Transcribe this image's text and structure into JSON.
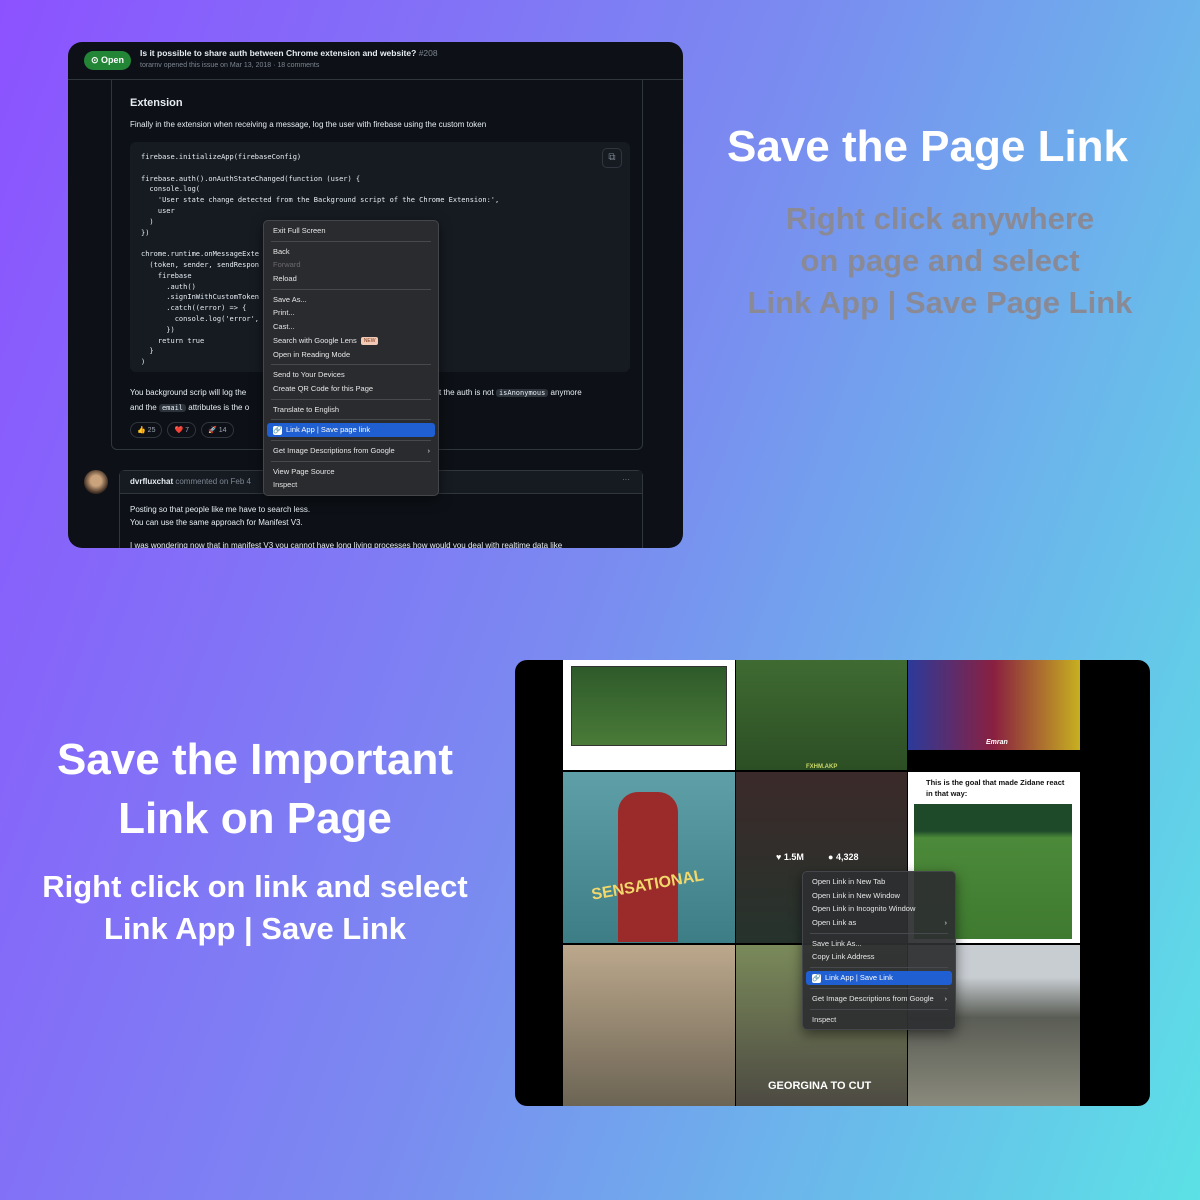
{
  "promo": {
    "top_title": "Save the Page Link",
    "top_sub": [
      "Right click anywhere",
      "on page and select",
      "Link App | Save Page Link"
    ],
    "bottom_title": [
      "Save the Important",
      "Link on Page"
    ],
    "bottom_sub": [
      "Right click  on link and select",
      "Link App | Save Link"
    ]
  },
  "colors": {
    "gradient_left": "#8c52ff",
    "gradient_right": "#5ce1e6",
    "subtitle_gray": "#8a8a96",
    "highlight": "#1f5fd1",
    "open_green": "#238636"
  },
  "issue": {
    "status": "Open",
    "title": "Is it possible to share auth between Chrome extension and website?",
    "number": "#208",
    "meta": "torarnv opened this issue on Mar 13, 2018 · 18 comments",
    "heading": "Extension",
    "intro": "Finally in the extension when receiving a message, log the user with firebase using the custom token",
    "code": "firebase.initializeApp(firebaseConfig)\n\nfirebase.auth().onAuthStateChanged(function (user) {\n  console.log(\n    'User state change detected from the Background script of the Chrome Extension:',\n    user\n  )\n})\n\nchrome.runtime.onMessageExte\n  (token, sender, sendRespon\n    firebase\n      .auth()\n      .signInWithCustomToken\n      .catch((error) => {\n        console.log('error',\n      })\n    return true\n  }\n)",
    "para_a": "You background scrip will log the",
    "para_b": "e that the auth is not",
    "code_inline1": "isAnonymous",
    "para_c": "anymore",
    "para_d": "and the",
    "code_inline2": "email",
    "para_e": "attributes is the o",
    "reactions": [
      {
        "emoji": "👍",
        "count": "25"
      },
      {
        "emoji": "❤️",
        "count": "7"
      },
      {
        "emoji": "🚀",
        "count": "14"
      }
    ],
    "comment_author": "dvrfluxchat",
    "comment_meta": "commented on Feb 4",
    "comment_more": "···",
    "comment_lines": [
      "Posting so that people like me have to search less.",
      "You can use the same approach for Manifest V3.",
      "",
      "I was wondering now that in manifest V3 you cannot have long living processes how would you deal with realtime data like"
    ]
  },
  "page_menu": {
    "items": [
      {
        "label": "Exit Full Screen"
      },
      {
        "sep": true
      },
      {
        "label": "Back"
      },
      {
        "label": "Forward",
        "disabled": true
      },
      {
        "label": "Reload"
      },
      {
        "sep": true
      },
      {
        "label": "Save As..."
      },
      {
        "label": "Print..."
      },
      {
        "label": "Cast..."
      },
      {
        "label": "Search with Google Lens",
        "badge": "NEW"
      },
      {
        "label": "Open in Reading Mode"
      },
      {
        "sep": true
      },
      {
        "label": "Send to Your Devices"
      },
      {
        "label": "Create QR Code for this Page"
      },
      {
        "sep": true
      },
      {
        "label": "Translate to English"
      },
      {
        "sep": true
      },
      {
        "label": "Link App | Save page link",
        "highlight": true,
        "icon": "link-app-icon"
      },
      {
        "sep": true
      },
      {
        "label": "Get Image Descriptions from Google",
        "submenu": true
      },
      {
        "sep": true
      },
      {
        "label": "View Page Source"
      },
      {
        "label": "Inspect"
      }
    ]
  },
  "link_menu": {
    "items": [
      {
        "label": "Open Link in New Tab"
      },
      {
        "label": "Open Link in New Window"
      },
      {
        "label": "Open Link in Incognito Window"
      },
      {
        "label": "Open Link as",
        "submenu": true
      },
      {
        "sep": true
      },
      {
        "label": "Save Link As..."
      },
      {
        "label": "Copy Link Address"
      },
      {
        "sep": true
      },
      {
        "label": "Link App | Save Link",
        "highlight": true,
        "icon": "link-app-icon"
      },
      {
        "sep": true
      },
      {
        "label": "Get Image Descriptions from Google",
        "submenu": true
      },
      {
        "sep": true
      },
      {
        "label": "Inspect"
      }
    ]
  },
  "feed": {
    "likes": "1.5M",
    "comments": "4,328",
    "tweet_text": "This is the goal that made Zidane react in that way:",
    "overlay1": "SENSATIONAL",
    "overlay2": "GEORGINA TO CUT",
    "overlay3": "Emran",
    "overlay4": "FXHM.AKP"
  }
}
